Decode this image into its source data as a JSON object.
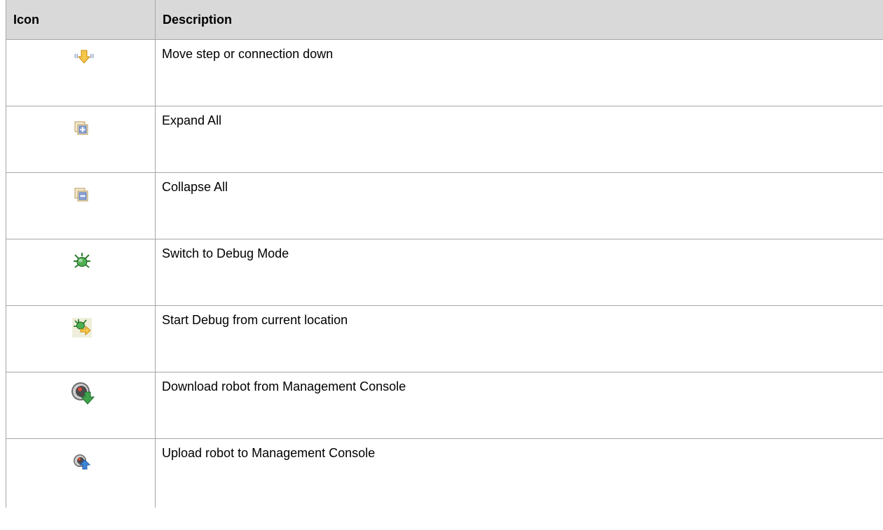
{
  "table": {
    "headers": {
      "icon": "Icon",
      "description": "Description"
    },
    "rows": [
      {
        "icon": "move-down-icon",
        "description": "Move step or connection down"
      },
      {
        "icon": "expand-all-icon",
        "description": "Expand All"
      },
      {
        "icon": "collapse-all-icon",
        "description": "Collapse All"
      },
      {
        "icon": "debug-mode-icon",
        "description": "Switch to Debug Mode"
      },
      {
        "icon": "start-debug-icon",
        "description": "Start Debug from current location"
      },
      {
        "icon": "download-robot-icon",
        "description": "Download robot from Management Console"
      },
      {
        "icon": "upload-robot-icon",
        "description": "Upload robot to Management Console"
      }
    ]
  },
  "colors": {
    "header_bg": "#d9d9d9",
    "border": "#a6a6a6"
  }
}
